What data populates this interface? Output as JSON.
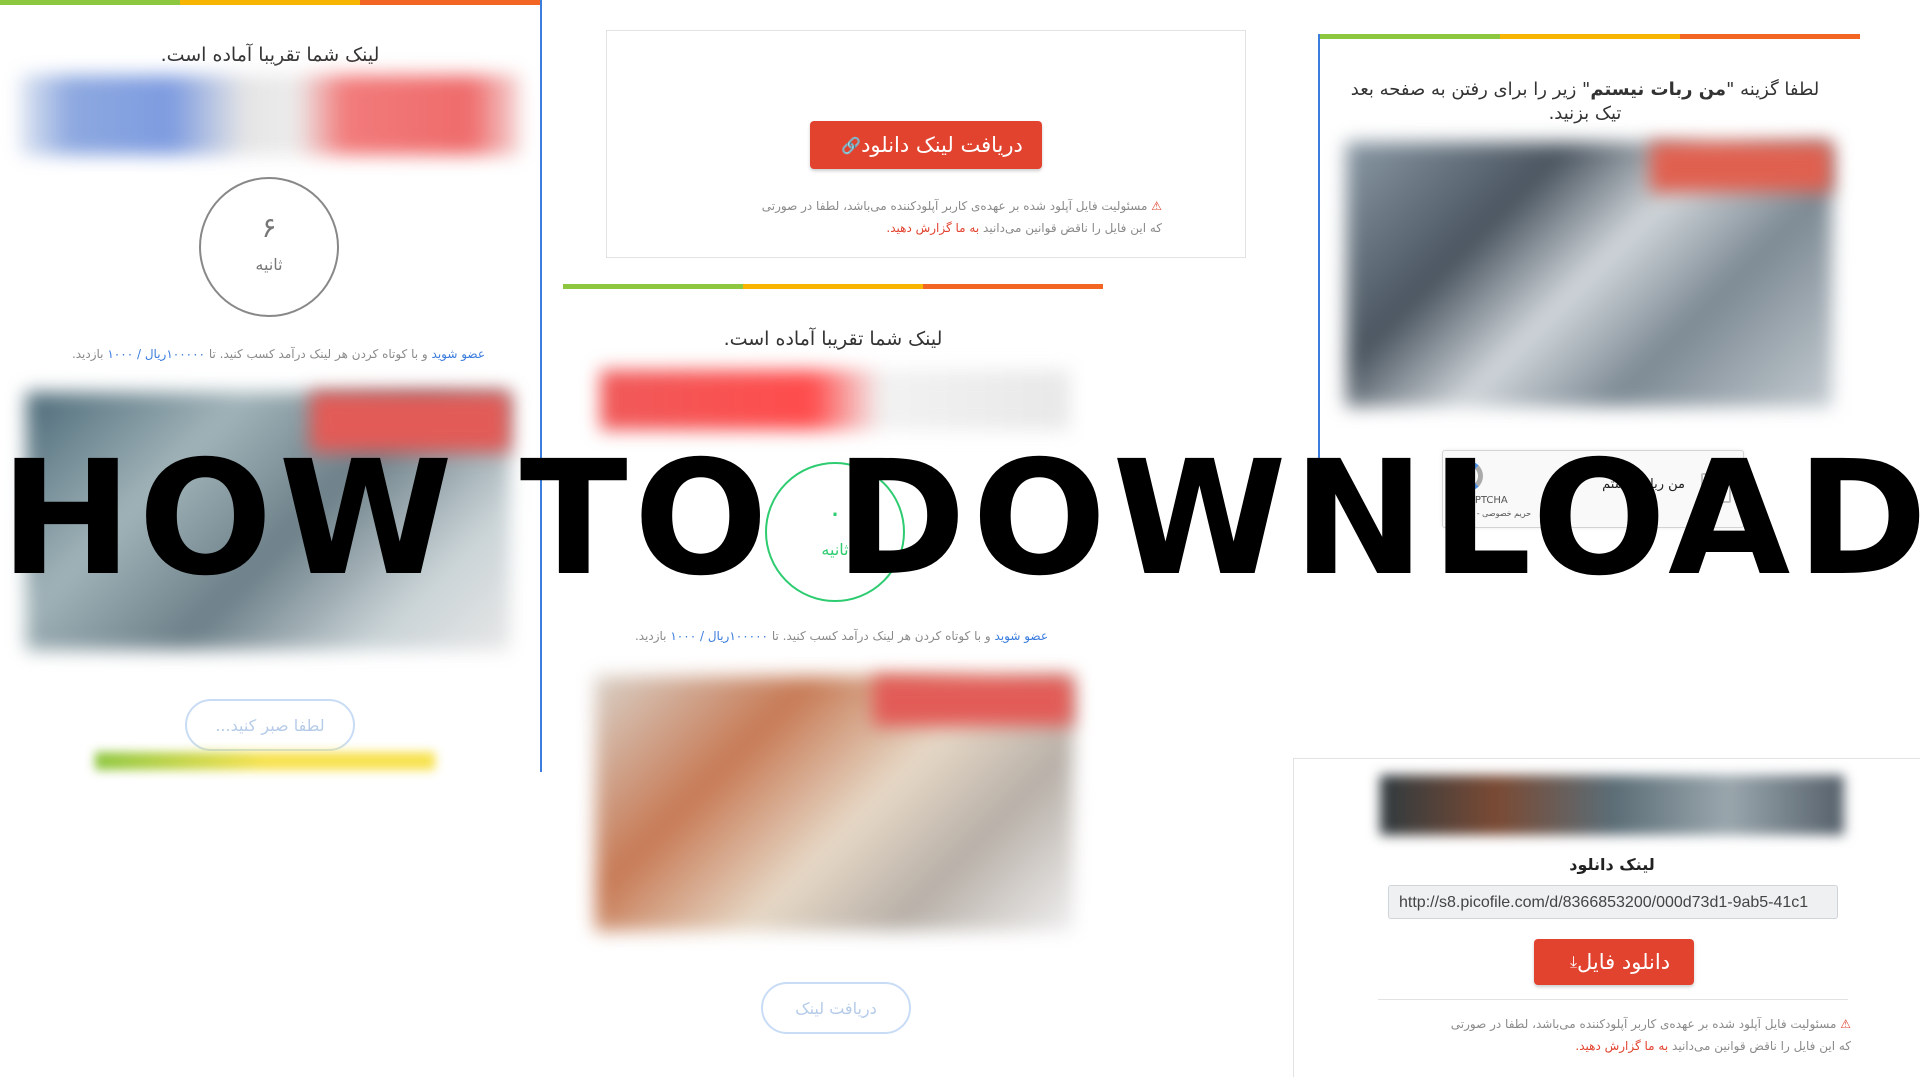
{
  "headline": "HOW TO DOWNLOAD",
  "colors": {
    "green": "#8dc63f",
    "yellow": "#f7b500",
    "orange": "#f26522",
    "red": "#e2432f",
    "blue_link": "#3b7ddd",
    "countdown_green": "#2ecc71"
  },
  "panel_left": {
    "title": "لینک شما تقریبا آماده است.",
    "countdown_value": "۶",
    "countdown_unit": "ثانیه",
    "promo_link": "عضو شوید",
    "promo_text_a": "و با کوتاه کردن هر لینک درآمد کسب کنید. تا",
    "promo_rate": "۱۰۰۰۰۰ریال / ۱۰۰۰",
    "promo_text_b": "بازدید.",
    "wait_button": "لطفا صبر کنید..."
  },
  "panel_top_center": {
    "button": "دریافت لینک دانلود",
    "button_icon": "link-icon",
    "warning_icon": "warning-triangle-icon",
    "disclaimer_line1": "مسئولیت فایل آپلود شده بر عهده‌ی کاربر آپلودکننده می‌باشد، لطفا در صورتی",
    "disclaimer_line2": "که این فایل را ناقض قوانین می‌دانید",
    "report_link": "به ما گزارش دهید."
  },
  "panel_mid_center": {
    "title": "لینک شما تقریبا آماده است.",
    "countdown_value": "۰",
    "countdown_unit": "ثانیه",
    "promo_link": "عضو شوید",
    "promo_text_a": "و با کوتاه کردن هر لینک درآمد کسب کنید. تا",
    "promo_rate": "۱۰۰۰۰۰ریال / ۱۰۰۰",
    "promo_text_b": "بازدید.",
    "get_link_button": "دریافت لینک"
  },
  "panel_right_top": {
    "instruction_a": "لطفا گزینه \"",
    "instruction_bold": "من ربات نیستم",
    "instruction_b": "\" زیر را برای رفتن به صفحه بعد تیک بزنید.",
    "recaptcha_label": "من ربات نیستم",
    "recaptcha_brand": "reCAPTCHA",
    "recaptcha_terms": "حریم خصوصی - شرایط"
  },
  "panel_right_bottom": {
    "label": "لینک دانلود",
    "url": "http://s8.picofile.com/d/8366853200/000d73d1-9ab5-41c1",
    "button": "دانلود فایل",
    "button_icon": "download-icon",
    "warning_icon": "warning-triangle-icon",
    "disclaimer_line1": "مسئولیت فایل آپلود شده بر عهده‌ی کاربر آپلودکننده می‌باشد، لطفا در صورتی",
    "disclaimer_line2": "که این فایل را ناقض قوانین می‌دانید",
    "report_link": "به ما گزارش دهید."
  }
}
